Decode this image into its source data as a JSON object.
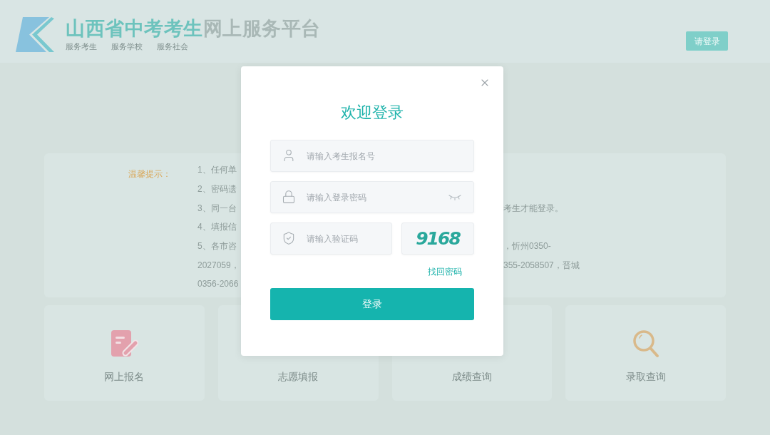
{
  "header": {
    "title": [
      {
        "text": "山西省中考考生",
        "highlight": true
      },
      {
        "text": "网上服务平台",
        "highlight": false
      }
    ],
    "taglines": [
      "服务考生",
      "服务学校",
      "服务社会"
    ],
    "login_button": "请登录"
  },
  "notice": {
    "label": "温馨提示：",
    "lines": [
      {
        "start": "1、任何单"
      },
      {
        "start": "2、密码遗"
      },
      {
        "start": "3、同一台",
        "end": "考生才能登录。"
      },
      {
        "start": "4、填报信"
      },
      {
        "start": "5、各市咨",
        "end": "，忻州0350-"
      },
      {
        "start": "2027059，",
        "end": "355-2058507，晋城"
      },
      {
        "start": "0356-2066"
      }
    ]
  },
  "services": [
    {
      "label": "网上报名",
      "kind": "form"
    },
    {
      "label": "志愿填报"
    },
    {
      "label": "成绩查询"
    },
    {
      "label": "录取查询",
      "kind": "search"
    }
  ],
  "login_dialog": {
    "title": "欢迎登录",
    "fields": [
      {
        "kind": "user",
        "placeholder": "请输入考生报名号"
      },
      {
        "kind": "password",
        "placeholder": "请输入登录密码"
      },
      {
        "kind": "captcha",
        "placeholder": "请输入验证码"
      }
    ],
    "captcha_code": "9168",
    "forgot_link": "找回密码",
    "submit_button": "登录"
  }
}
